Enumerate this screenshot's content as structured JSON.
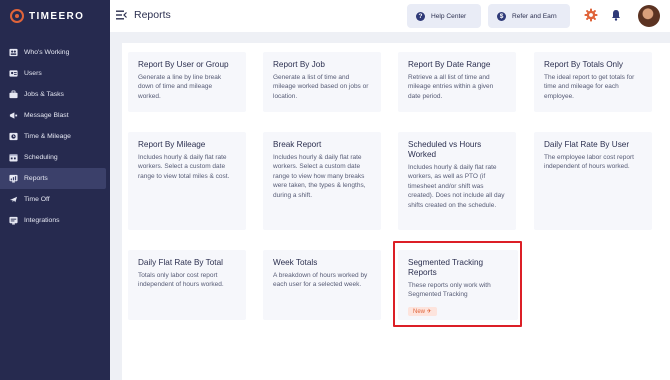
{
  "app": {
    "name": "TIMEERO"
  },
  "sidebar": {
    "items": [
      {
        "label": "Who's Working",
        "icon": "users-group-icon"
      },
      {
        "label": "Users",
        "icon": "user-card-icon"
      },
      {
        "label": "Jobs & Tasks",
        "icon": "briefcase-icon"
      },
      {
        "label": "Message Blast",
        "icon": "megaphone-icon"
      },
      {
        "label": "Time & Mileage",
        "icon": "time-mileage-icon"
      },
      {
        "label": "Scheduling",
        "icon": "calendar-icon"
      },
      {
        "label": "Reports",
        "icon": "reports-icon",
        "active": true
      },
      {
        "label": "Time Off",
        "icon": "airplane-icon"
      },
      {
        "label": "Integrations",
        "icon": "integrations-icon"
      }
    ]
  },
  "header": {
    "title": "Reports",
    "help_label": "Help Center",
    "refer_label": "Refer and Earn"
  },
  "reports": [
    {
      "title": "Report By User or Group",
      "description": "Generate a line by line break down of time and mileage worked."
    },
    {
      "title": "Report By Job",
      "description": "Generate a list of time and mileage worked based on jobs or location."
    },
    {
      "title": "Report By Date Range",
      "description": "Retrieve a all list of time and mileage entries within a given date period."
    },
    {
      "title": "Report By Totals Only",
      "description": "The ideal report to get totals for time and mileage for each employee."
    },
    {
      "title": "Report By Mileage",
      "description": "Includes hourly & daily flat rate workers. Select a custom date range to view total miles & cost."
    },
    {
      "title": "Break Report",
      "description": "Includes hourly & daily flat rate workers. Select a custom date range to view how many breaks were taken, the types & lengths, during a shift."
    },
    {
      "title": "Scheduled vs Hours Worked",
      "description": "Includes hourly & daily flat rate workers, as well as PTO (if timesheet and/or shift was created). Does not include all day shifts created on the schedule."
    },
    {
      "title": "Daily Flat Rate By User",
      "description": "The employee labor cost report independent of hours worked."
    },
    {
      "title": "Daily Flat Rate By Total",
      "description": "Totals only labor cost report independent of hours worked."
    },
    {
      "title": "Week Totals",
      "description": "A breakdown of hours worked by each user for a selected week."
    },
    {
      "title": "Segmented Tracking Reports",
      "description": "These reports only work with Segmented Tracking",
      "badge": "New ✈"
    }
  ],
  "colors": {
    "sidebar": "#262a4f",
    "accent": "#e0643a",
    "highlight": "#dc1f26",
    "card": "#f6f7fb"
  }
}
